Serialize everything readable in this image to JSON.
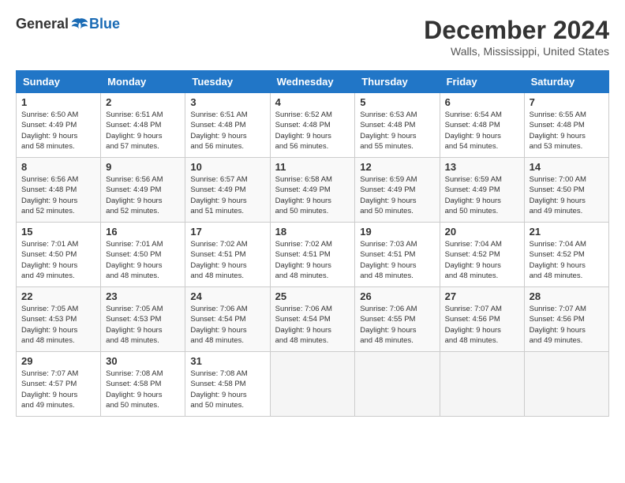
{
  "logo": {
    "general": "General",
    "blue": "Blue"
  },
  "title": {
    "month": "December 2024",
    "location": "Walls, Mississippi, United States"
  },
  "weekdays": [
    "Sunday",
    "Monday",
    "Tuesday",
    "Wednesday",
    "Thursday",
    "Friday",
    "Saturday"
  ],
  "weeks": [
    [
      {
        "day": "1",
        "sunrise": "6:50 AM",
        "sunset": "4:49 PM",
        "daylight": "9 hours and 58 minutes."
      },
      {
        "day": "2",
        "sunrise": "6:51 AM",
        "sunset": "4:48 PM",
        "daylight": "9 hours and 57 minutes."
      },
      {
        "day": "3",
        "sunrise": "6:51 AM",
        "sunset": "4:48 PM",
        "daylight": "9 hours and 56 minutes."
      },
      {
        "day": "4",
        "sunrise": "6:52 AM",
        "sunset": "4:48 PM",
        "daylight": "9 hours and 56 minutes."
      },
      {
        "day": "5",
        "sunrise": "6:53 AM",
        "sunset": "4:48 PM",
        "daylight": "9 hours and 55 minutes."
      },
      {
        "day": "6",
        "sunrise": "6:54 AM",
        "sunset": "4:48 PM",
        "daylight": "9 hours and 54 minutes."
      },
      {
        "day": "7",
        "sunrise": "6:55 AM",
        "sunset": "4:48 PM",
        "daylight": "9 hours and 53 minutes."
      }
    ],
    [
      {
        "day": "8",
        "sunrise": "6:56 AM",
        "sunset": "4:48 PM",
        "daylight": "9 hours and 52 minutes."
      },
      {
        "day": "9",
        "sunrise": "6:56 AM",
        "sunset": "4:49 PM",
        "daylight": "9 hours and 52 minutes."
      },
      {
        "day": "10",
        "sunrise": "6:57 AM",
        "sunset": "4:49 PM",
        "daylight": "9 hours and 51 minutes."
      },
      {
        "day": "11",
        "sunrise": "6:58 AM",
        "sunset": "4:49 PM",
        "daylight": "9 hours and 50 minutes."
      },
      {
        "day": "12",
        "sunrise": "6:59 AM",
        "sunset": "4:49 PM",
        "daylight": "9 hours and 50 minutes."
      },
      {
        "day": "13",
        "sunrise": "6:59 AM",
        "sunset": "4:49 PM",
        "daylight": "9 hours and 50 minutes."
      },
      {
        "day": "14",
        "sunrise": "7:00 AM",
        "sunset": "4:50 PM",
        "daylight": "9 hours and 49 minutes."
      }
    ],
    [
      {
        "day": "15",
        "sunrise": "7:01 AM",
        "sunset": "4:50 PM",
        "daylight": "9 hours and 49 minutes."
      },
      {
        "day": "16",
        "sunrise": "7:01 AM",
        "sunset": "4:50 PM",
        "daylight": "9 hours and 48 minutes."
      },
      {
        "day": "17",
        "sunrise": "7:02 AM",
        "sunset": "4:51 PM",
        "daylight": "9 hours and 48 minutes."
      },
      {
        "day": "18",
        "sunrise": "7:02 AM",
        "sunset": "4:51 PM",
        "daylight": "9 hours and 48 minutes."
      },
      {
        "day": "19",
        "sunrise": "7:03 AM",
        "sunset": "4:51 PM",
        "daylight": "9 hours and 48 minutes."
      },
      {
        "day": "20",
        "sunrise": "7:04 AM",
        "sunset": "4:52 PM",
        "daylight": "9 hours and 48 minutes."
      },
      {
        "day": "21",
        "sunrise": "7:04 AM",
        "sunset": "4:52 PM",
        "daylight": "9 hours and 48 minutes."
      }
    ],
    [
      {
        "day": "22",
        "sunrise": "7:05 AM",
        "sunset": "4:53 PM",
        "daylight": "9 hours and 48 minutes."
      },
      {
        "day": "23",
        "sunrise": "7:05 AM",
        "sunset": "4:53 PM",
        "daylight": "9 hours and 48 minutes."
      },
      {
        "day": "24",
        "sunrise": "7:06 AM",
        "sunset": "4:54 PM",
        "daylight": "9 hours and 48 minutes."
      },
      {
        "day": "25",
        "sunrise": "7:06 AM",
        "sunset": "4:54 PM",
        "daylight": "9 hours and 48 minutes."
      },
      {
        "day": "26",
        "sunrise": "7:06 AM",
        "sunset": "4:55 PM",
        "daylight": "9 hours and 48 minutes."
      },
      {
        "day": "27",
        "sunrise": "7:07 AM",
        "sunset": "4:56 PM",
        "daylight": "9 hours and 48 minutes."
      },
      {
        "day": "28",
        "sunrise": "7:07 AM",
        "sunset": "4:56 PM",
        "daylight": "9 hours and 49 minutes."
      }
    ],
    [
      {
        "day": "29",
        "sunrise": "7:07 AM",
        "sunset": "4:57 PM",
        "daylight": "9 hours and 49 minutes."
      },
      {
        "day": "30",
        "sunrise": "7:08 AM",
        "sunset": "4:58 PM",
        "daylight": "9 hours and 50 minutes."
      },
      {
        "day": "31",
        "sunrise": "7:08 AM",
        "sunset": "4:58 PM",
        "daylight": "9 hours and 50 minutes."
      },
      null,
      null,
      null,
      null
    ]
  ],
  "labels": {
    "sunrise": "Sunrise:",
    "sunset": "Sunset:",
    "daylight": "Daylight:"
  }
}
